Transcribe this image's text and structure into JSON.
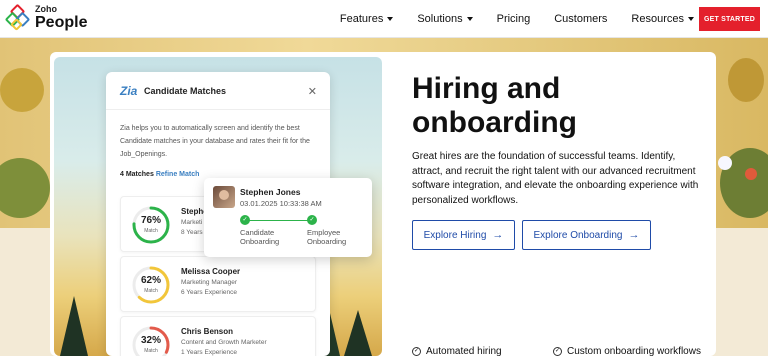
{
  "brand": {
    "name": "Zoho",
    "product": "People"
  },
  "nav": {
    "items": [
      {
        "label": "Features",
        "dropdown": true
      },
      {
        "label": "Solutions",
        "dropdown": true
      },
      {
        "label": "Pricing",
        "dropdown": false
      },
      {
        "label": "Customers",
        "dropdown": false
      },
      {
        "label": "Resources",
        "dropdown": true
      }
    ],
    "cta_label": "GET STARTED"
  },
  "panel": {
    "title": "Candidate Matches",
    "description": "Zia helps you to automatically screen and identify the best Candidate matches in your database and rates their fit for the Job_Openings.",
    "match_count": "4 Matches",
    "refine_label": "Refine Match",
    "candidates": [
      {
        "name": "Stephen Jones",
        "name_visible": "Stephe",
        "role": "Marketi",
        "experience": "8 Years",
        "percent_label": "76%",
        "score": 76,
        "match_label": "Match",
        "color": "#2cb34a"
      },
      {
        "name": "Melissa Cooper",
        "role": "Marketing Manager",
        "experience": "6 Years Experience",
        "percent_label": "62%",
        "score": 62,
        "match_label": "Match",
        "color": "#f2c63a"
      },
      {
        "name": "Chris Benson",
        "role": "Content and Growth Marketer",
        "experience": "1 Years Experience",
        "percent_label": "32%",
        "score": 32,
        "match_label": "Match",
        "color": "#e35b4b"
      }
    ]
  },
  "popover": {
    "name": "Stephen Jones",
    "timestamp": "03.01.2025  10:33:38 AM",
    "steps": [
      "Candidate Onboarding",
      "Employee Onboarding"
    ]
  },
  "hero": {
    "title": "Hiring and onboarding",
    "description": "Great hires are the foundation of successful teams. Identify, attract, and recruit the right talent with our advanced recruitment software integration, and elevate the onboarding experience with personalized workflows.",
    "buttons": [
      {
        "label": "Explore Hiring"
      },
      {
        "label": "Explore Onboarding"
      }
    ],
    "features": [
      "Automated hiring",
      "Custom onboarding workflows"
    ]
  },
  "colors": {
    "accent": "#1f4ba8",
    "cta": "#e4202c",
    "success": "#2cb34a"
  }
}
